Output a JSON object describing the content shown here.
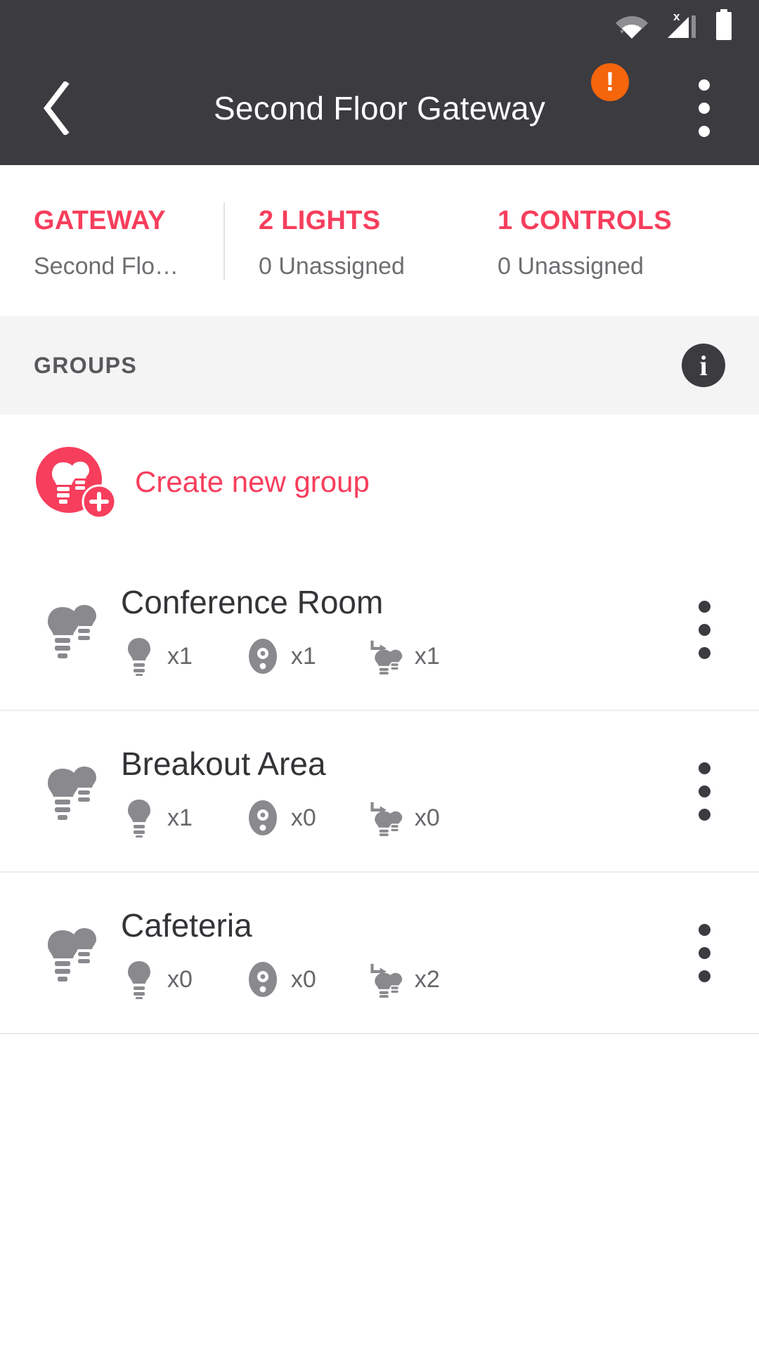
{
  "statusbar": {
    "icons": [
      "wifi-icon",
      "cellular-signal-x-icon",
      "battery-icon"
    ]
  },
  "appbar": {
    "back_icon": "chevron-left-icon",
    "title": "Second Floor Gateway",
    "warning_icon": "exclamation-badge-icon",
    "warning_glyph": "!",
    "overflow_icon": "more-vertical-icon"
  },
  "summary": [
    {
      "title": "GATEWAY",
      "subtitle": "Second Flo…"
    },
    {
      "title": "2 LIGHTS",
      "subtitle": "0 Unassigned"
    },
    {
      "title": "1 CONTROLS",
      "subtitle": "0 Unassigned"
    }
  ],
  "section": {
    "title": "GROUPS",
    "info_icon": "info-icon",
    "info_glyph": "i"
  },
  "create": {
    "icon": "add-group-bulbs-icon",
    "label": "Create new group"
  },
  "groups": [
    {
      "icon": "two-bulbs-icon",
      "name": "Conference Room",
      "metrics": [
        {
          "icon": "bulb-icon",
          "value": "x1"
        },
        {
          "icon": "control-icon",
          "value": "x1"
        },
        {
          "icon": "scene-icon",
          "value": "x1"
        }
      ],
      "overflow_icon": "more-vertical-icon"
    },
    {
      "icon": "two-bulbs-icon",
      "name": "Breakout Area",
      "metrics": [
        {
          "icon": "bulb-icon",
          "value": "x1"
        },
        {
          "icon": "control-icon",
          "value": "x0"
        },
        {
          "icon": "scene-icon",
          "value": "x0"
        }
      ],
      "overflow_icon": "more-vertical-icon"
    },
    {
      "icon": "two-bulbs-icon",
      "name": "Cafeteria",
      "metrics": [
        {
          "icon": "bulb-icon",
          "value": "x0"
        },
        {
          "icon": "control-icon",
          "value": "x0"
        },
        {
          "icon": "scene-icon",
          "value": "x2"
        }
      ],
      "overflow_icon": "more-vertical-icon"
    }
  ],
  "colors": {
    "accent": "#f73e5c",
    "appbar_bg": "#3c3b40",
    "warning": "#f4650c",
    "section_bg": "#f4f4f5",
    "muted_text": "#6e6e72",
    "icon_gray": "#8a8a8e"
  }
}
